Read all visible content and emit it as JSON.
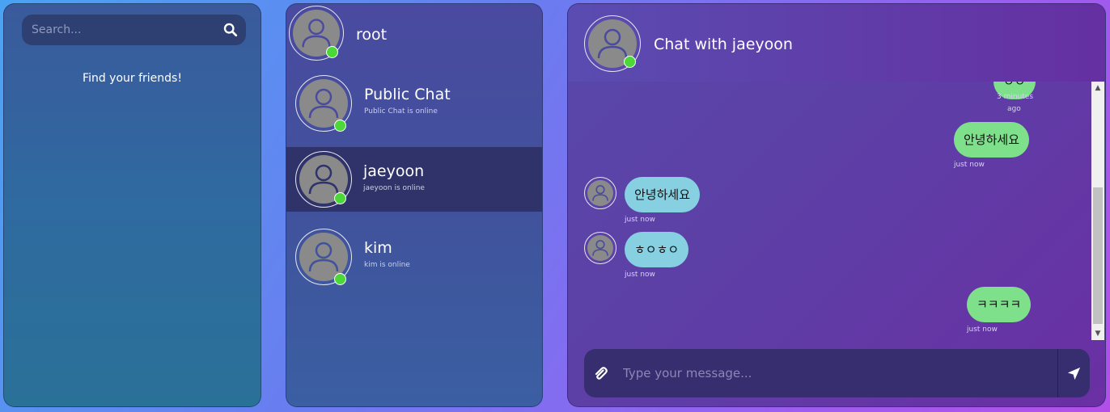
{
  "search": {
    "placeholder": "Search..."
  },
  "friends": {
    "empty_text": "Find your friends!"
  },
  "current_user": {
    "name": "root",
    "online": true
  },
  "contacts": [
    {
      "name": "Public Chat",
      "status": "Public Chat is online",
      "online": true,
      "active": false
    },
    {
      "name": "jaeyoon",
      "status": "jaeyoon is online",
      "online": true,
      "active": true
    },
    {
      "name": "kim",
      "status": "kim is online",
      "online": true,
      "active": false
    }
  ],
  "chat": {
    "title": "Chat with jaeyoon",
    "messages": [
      {
        "direction": "out",
        "text": "ㅇㅇ",
        "time_line1": "3 minutes",
        "time_line2": "ago"
      },
      {
        "direction": "out",
        "text": "안녕하세요",
        "time": "just now"
      },
      {
        "direction": "in",
        "text": "안녕하세요",
        "time": "just now"
      },
      {
        "direction": "in",
        "text": "ㅎㅇㅎㅇ",
        "time": "just now"
      },
      {
        "direction": "out",
        "text": "ㅋㅋㅋㅋ",
        "time": "just now"
      }
    ]
  },
  "composer": {
    "placeholder": "Type your message..."
  },
  "icons": {
    "search": "search-icon",
    "attach": "paperclip-icon",
    "send": "send-icon",
    "avatar": "user-icon"
  },
  "colors": {
    "online": "#4dd83a",
    "bubble_out": "#7fe08c",
    "bubble_in": "#86d0e2",
    "active_contact": "#30336a"
  }
}
